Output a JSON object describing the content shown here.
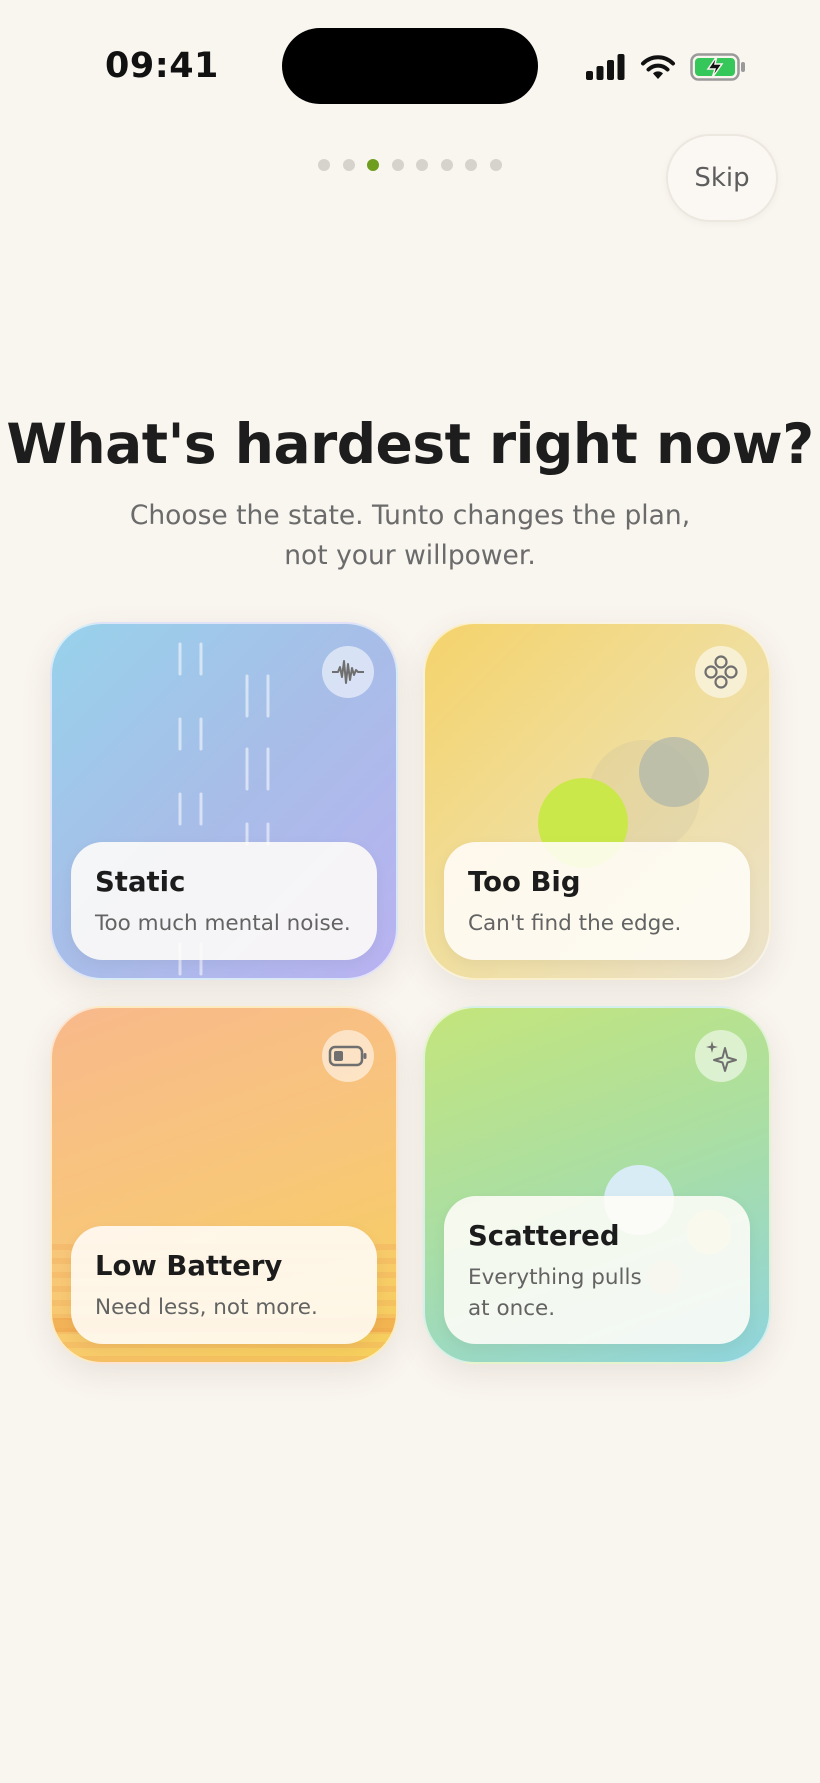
{
  "status_bar": {
    "time": "09:41"
  },
  "pager": {
    "count": 8,
    "active_index": 2
  },
  "header": {
    "skip_label": "Skip"
  },
  "main": {
    "title": "What's hardest right now?",
    "subtitle": "Choose the state. Tunto changes the plan, not your willpower."
  },
  "cards": [
    {
      "title": "Static",
      "description": "Too much mental noise.",
      "icon": "waveform-icon"
    },
    {
      "title": "Too Big",
      "description": "Can't find the edge.",
      "icon": "circles-icon"
    },
    {
      "title": "Low Battery",
      "description": "Need less, not more.",
      "icon": "battery-low-icon"
    },
    {
      "title": "Scattered",
      "description": "Everything pulls at once.",
      "icon": "sparkle-icon"
    }
  ],
  "colors": {
    "accent": "#6f9d1e",
    "background": "#f9f5ef"
  }
}
